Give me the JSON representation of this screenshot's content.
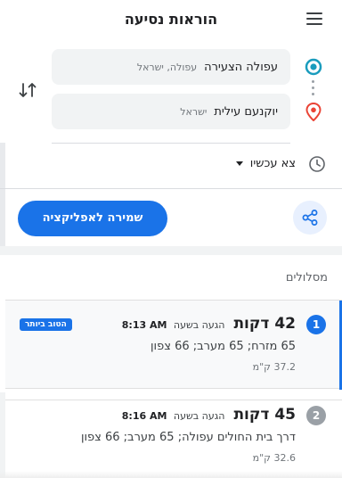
{
  "header": {
    "title": "הוראות נסיעה"
  },
  "icons": {
    "menu": "hamburger-icon",
    "origin": "origin-dot-icon",
    "destination": "map-pin-icon",
    "swap": "swap-arrows-icon",
    "clock": "clock-icon",
    "share": "share-icon"
  },
  "colors": {
    "accent": "#1a73e8",
    "origin_icon": "#1a9cbd",
    "destination_icon": "#ea4335",
    "field_bg": "#f1f3f4",
    "muted": "#9aa0a6"
  },
  "route_inputs": {
    "origin": {
      "main": "עפולה הצעירה",
      "sub": "עפולה, ישראל"
    },
    "destination": {
      "main": "יוקנעם עילית",
      "sub": "ישראל"
    }
  },
  "depart": {
    "label": "צא עכשיו"
  },
  "actions": {
    "save_label": "שמירה לאפליקציה"
  },
  "routes_section": {
    "label": "מסלולים",
    "routes": [
      {
        "number": "1",
        "duration": "42 דקות",
        "arrival_label": "הגעה בשעה",
        "arrival_time": "8:13 AM",
        "via": "65 מזרח; 65 מערב; 66 צפון",
        "distance": "37.2 ק\"מ",
        "badge": "הטוב ביותר"
      },
      {
        "number": "2",
        "duration": "45 דקות",
        "arrival_label": "הגעה בשעה",
        "arrival_time": "8:16 AM",
        "via": "דרך בית החולים עפולה; 65 מערב; 66 צפון",
        "distance": "32.6 ק\"מ"
      }
    ]
  }
}
